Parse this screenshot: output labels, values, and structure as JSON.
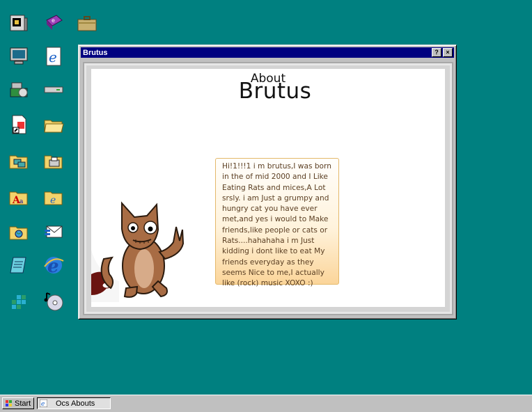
{
  "desktop": {
    "icons": [
      {
        "name": "my-computer-icon"
      },
      {
        "name": "reader-book-icon"
      },
      {
        "name": "briefcase-icon"
      },
      {
        "name": "monitor-icon"
      },
      {
        "name": "internet-explorer-icon"
      },
      {
        "name": "control-panel-icon"
      },
      {
        "name": "drive-icon"
      },
      {
        "name": "shortcut-file-icon"
      },
      {
        "name": "open-folder-icon"
      },
      {
        "name": "network-folder-icon"
      },
      {
        "name": "printer-folder-icon"
      },
      {
        "name": "fonts-folder-icon"
      },
      {
        "name": "web-folder-icon"
      },
      {
        "name": "globe-folder-icon"
      },
      {
        "name": "mail-icon"
      },
      {
        "name": "notepad-icon"
      },
      {
        "name": "internet-explorer-large-icon"
      },
      {
        "name": "windows-update-icon"
      },
      {
        "name": "music-cd-icon"
      }
    ]
  },
  "window": {
    "title": "Brutus",
    "help_label": "?",
    "close_label": "×",
    "heading_small": "About",
    "heading_big": "Brutus",
    "bio": "Hi!1!!!1 i m brutus,I was born in the of mid 2000 and I Like Eating Rats and mices,A Lot srsly. i am Just a grumpy and hungry cat you have ever met,and yes i would to Make friends,like people or cats or Rats....hahahaha i m Just kidding i dont like to eat My friends everyday as they seems Nice to me,I actually like (rock) music XOXO :)"
  },
  "taskbar": {
    "start_label": "Start",
    "task_label": "Ocs Abouts"
  },
  "colors": {
    "desktop": "#008080",
    "titlebar": "#000080",
    "bubble_border": "#e4b86a",
    "cat_fur": "#a86c44"
  }
}
